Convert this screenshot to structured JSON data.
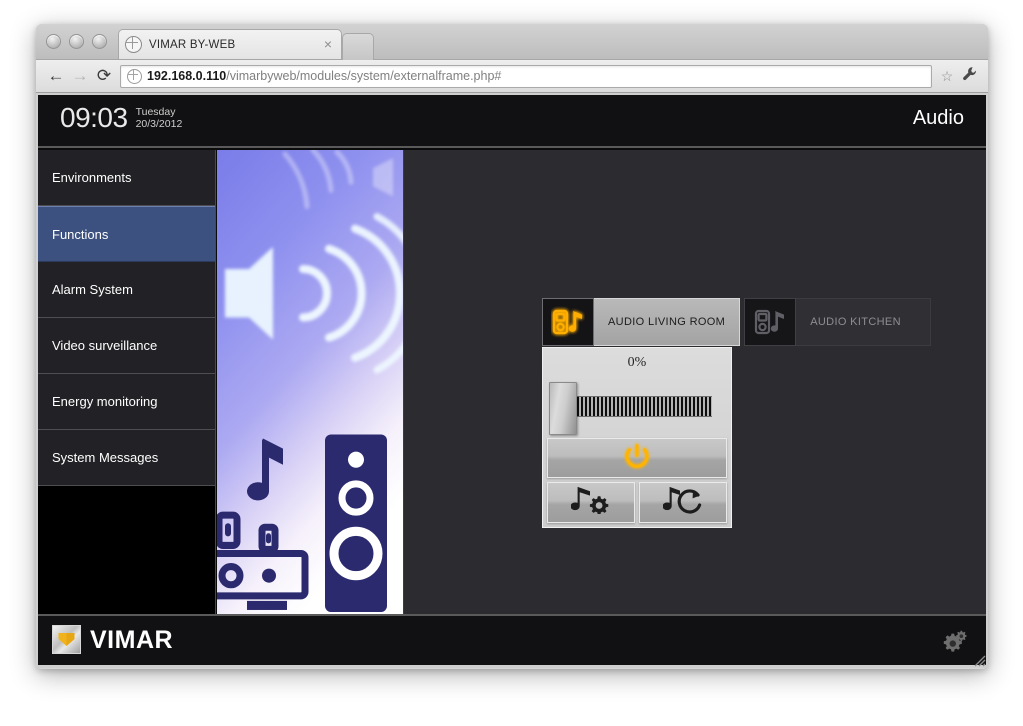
{
  "browser": {
    "tab": {
      "title": "VIMAR BY-WEB",
      "close_label": "×",
      "favicon_name": "globe-icon"
    },
    "toolbar": {
      "back_label": "←",
      "forward_label": "→",
      "reload_label": "⟳",
      "url_host": "192.168.0.110",
      "url_path": "/vimarbyweb/modules/system/externalframe.php#",
      "star_label": "☆",
      "wrench_name": "wrench-icon"
    },
    "traffic_lights": [
      "close",
      "minimize",
      "zoom"
    ]
  },
  "app": {
    "header": {
      "time": "09:03",
      "day": "Tuesday",
      "date": "20/3/2012",
      "page_title": "Audio"
    },
    "sidebar": {
      "items": [
        {
          "label": "Environments",
          "selected": false
        },
        {
          "label": "Functions",
          "selected": true
        },
        {
          "label": "Alarm System",
          "selected": false
        },
        {
          "label": "Video surveillance",
          "selected": false
        },
        {
          "label": "Energy monitoring",
          "selected": false
        },
        {
          "label": "System Messages",
          "selected": false
        }
      ]
    },
    "illustration": {
      "name": "audio-speaker-illustration",
      "description": "Speaker with sound waves, music note, hi-fi system and loudspeaker tower"
    },
    "zones": [
      {
        "label": "AUDIO LIVING ROOM",
        "active": true,
        "icon": "media-player-note-icon"
      },
      {
        "label": "AUDIO KITCHEN",
        "active": false,
        "icon": "media-player-note-icon"
      }
    ],
    "controls": {
      "volume_percent": "0%",
      "volume_value": 0,
      "power_button_name": "power-icon",
      "settings_button_name": "note-gear-icon",
      "source_button_name": "note-cycle-icon"
    },
    "footer": {
      "brand": "VIMAR",
      "settings_icon": "gears-icon"
    },
    "colors": {
      "accent_orange": "#ffb000",
      "selected_blue": "#3d5180",
      "panel_dark": "#2c2c30",
      "header_black": "#111113"
    }
  }
}
